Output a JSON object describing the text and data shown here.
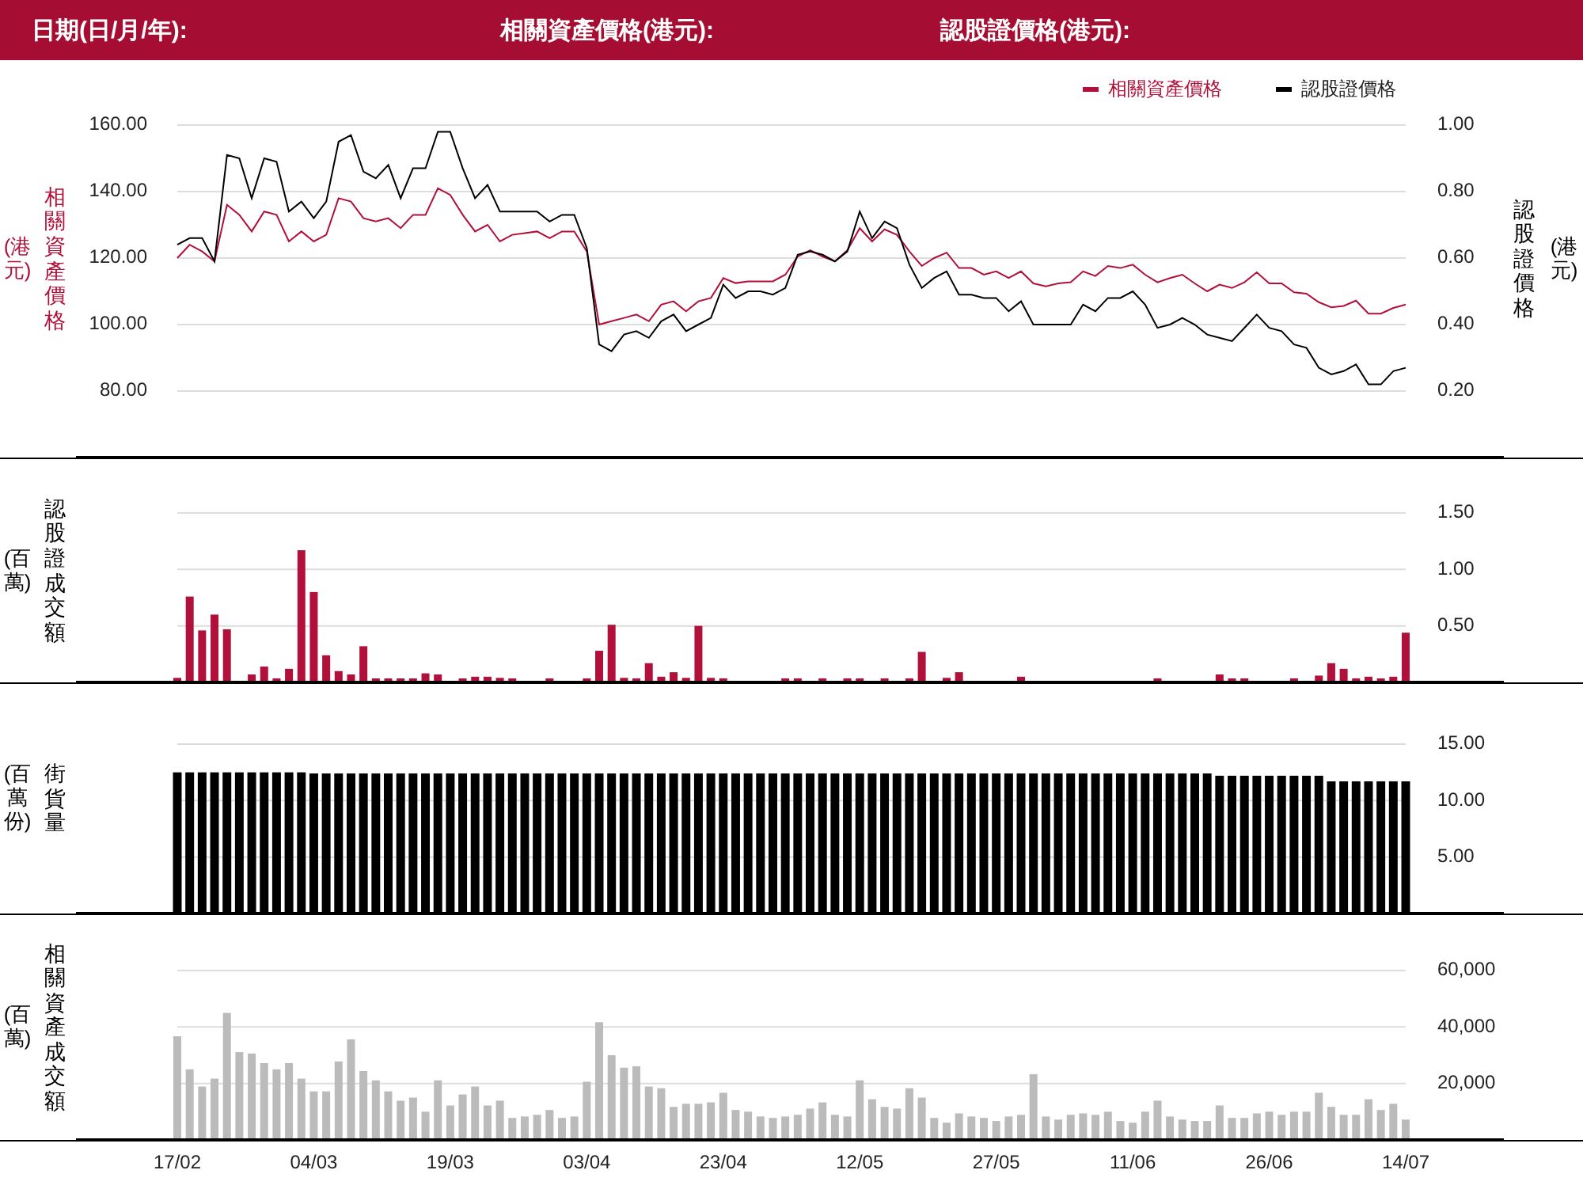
{
  "header": {
    "fields": [
      {
        "label": "日期(日/月/年):"
      },
      {
        "label": "相關資產價格(港元):"
      },
      {
        "label": "認股證價格(港元):"
      }
    ]
  },
  "panels": [
    {
      "unit": "(港元)",
      "chart_data": {
        "type": "line",
        "ylabel": "相關資產價格",
        "grid": true,
        "legend": true,
        "ylim": [
          60,
          160
        ],
        "yticks": [
          {
            "value": 160,
            "label": "160.00"
          },
          {
            "value": 140,
            "label": "140.00"
          },
          {
            "value": 120,
            "label": "120.00"
          },
          {
            "value": 100,
            "label": "100.00"
          },
          {
            "value": 80,
            "label": "80.00"
          }
        ],
        "series": [
          {
            "name": "相關資產價格",
            "color": "#b0103a",
            "values": [
              120,
              124,
              122,
              119,
              136,
              133,
              128,
              134,
              133,
              125,
              128,
              125,
              127,
              138,
              137,
              132,
              131,
              132,
              129,
              133,
              133,
              141,
              139,
              133,
              128,
              130,
              125,
              127,
              127.5,
              128,
              126,
              128,
              128,
              122,
              100,
              101,
              102,
              103,
              101,
              106,
              107,
              104,
              107,
              108,
              114,
              112.5,
              113,
              113,
              113,
              115,
              120.5,
              122.4,
              120.5,
              119,
              122.4,
              129,
              125,
              128.6,
              127,
              122,
              117.6,
              120,
              121.6,
              117,
              117,
              115,
              116,
              114,
              116,
              112.4,
              111.5,
              112.4,
              112.7,
              116,
              114.6,
              117.6,
              117,
              118,
              115,
              112.7,
              114,
              115,
              112.4,
              110,
              112,
              111,
              112.7,
              115.7,
              112.4,
              112.4,
              109.7,
              109.3,
              106.7,
              105.2,
              105.6,
              107.2,
              103.3,
              103.3,
              105,
              106
            ]
          }
        ]
      },
      "overlay": {
        "unit": "(港元)",
        "chart_data": {
          "type": "line",
          "ylabel": "認股證價格",
          "legend": true,
          "ylim": [
            0,
            1.0
          ],
          "yticks": [
            {
              "value": 1.0,
              "label": "1.00"
            },
            {
              "value": 0.8,
              "label": "0.80"
            },
            {
              "value": 0.6,
              "label": "0.60"
            },
            {
              "value": 0.4,
              "label": "0.40"
            },
            {
              "value": 0.2,
              "label": "0.20"
            }
          ],
          "series": [
            {
              "name": "認股證價格",
              "color": "#000000",
              "values": [
                0.64,
                0.66,
                0.66,
                0.59,
                0.91,
                0.9,
                0.78,
                0.9,
                0.89,
                0.74,
                0.77,
                0.72,
                0.77,
                0.95,
                0.97,
                0.86,
                0.84,
                0.88,
                0.78,
                0.87,
                0.87,
                0.98,
                0.98,
                0.87,
                0.78,
                0.82,
                0.74,
                0.74,
                0.74,
                0.74,
                0.71,
                0.73,
                0.73,
                0.63,
                0.34,
                0.32,
                0.37,
                0.38,
                0.36,
                0.41,
                0.43,
                0.38,
                0.4,
                0.42,
                0.52,
                0.48,
                0.5,
                0.5,
                0.49,
                0.51,
                0.61,
                0.62,
                0.61,
                0.59,
                0.62,
                0.74,
                0.66,
                0.71,
                0.69,
                0.58,
                0.51,
                0.54,
                0.56,
                0.49,
                0.49,
                0.48,
                0.48,
                0.44,
                0.47,
                0.4,
                0.4,
                0.4,
                0.4,
                0.46,
                0.44,
                0.48,
                0.48,
                0.5,
                0.46,
                0.39,
                0.4,
                0.42,
                0.4,
                0.37,
                0.36,
                0.35,
                0.39,
                0.43,
                0.39,
                0.38,
                0.34,
                0.33,
                0.27,
                0.25,
                0.26,
                0.28,
                0.22,
                0.22,
                0.26,
                0.27
              ]
            }
          ]
        }
      }
    },
    {
      "unit": "(百萬)",
      "chart_data": {
        "type": "bar",
        "ylabel": "認股證成交額",
        "grid": true,
        "ylim": [
          0,
          1.5
        ],
        "yticks": [
          {
            "value": 1.5,
            "label": "1.50"
          },
          {
            "value": 1.0,
            "label": "1.00"
          },
          {
            "value": 0.5,
            "label": "0.50"
          }
        ],
        "series": [
          {
            "color": "#b0103a",
            "values": [
              0.04,
              0.76,
              0.46,
              0.6,
              0.47,
              0,
              0.07,
              0.14,
              0.03,
              0.12,
              1.17,
              0.8,
              0.24,
              0.1,
              0.07,
              0.32,
              0.02,
              0.03,
              0.02,
              0.02,
              0.08,
              0.07,
              0,
              0.03,
              0.05,
              0.05,
              0.04,
              0.02,
              0,
              0,
              0.02,
              0,
              0,
              0.03,
              0.28,
              0.51,
              0.04,
              0.02,
              0.17,
              0.05,
              0.09,
              0.04,
              0.5,
              0.04,
              0.02,
              0,
              0,
              0,
              0,
              0.02,
              0.02,
              0,
              0.02,
              0,
              0.03,
              0.02,
              0,
              0.03,
              0,
              0.03,
              0.27,
              0,
              0.04,
              0.09,
              0,
              0,
              0,
              0,
              0.05,
              0,
              0,
              0,
              0,
              0,
              0,
              0,
              0,
              0,
              0,
              0.01,
              0,
              0,
              0,
              0,
              0.07,
              0.02,
              0.02,
              0,
              0,
              0,
              0.02,
              0,
              0.06,
              0.17,
              0.12,
              0.02,
              0.05,
              0.01,
              0.05,
              0.44
            ]
          }
        ]
      }
    },
    {
      "unit": "(百萬份)",
      "chart_data": {
        "type": "bar",
        "ylabel": "街貨量",
        "grid": true,
        "ylim": [
          0,
          15
        ],
        "yticks": [
          {
            "value": 15,
            "label": "15.00"
          },
          {
            "value": 10,
            "label": "10.00"
          },
          {
            "value": 5,
            "label": "5.00"
          }
        ],
        "series": [
          {
            "color": "#000000",
            "values": [
              12.5,
              12.5,
              12.5,
              12.5,
              12.5,
              12.5,
              12.5,
              12.5,
              12.5,
              12.5,
              12.5,
              12.4,
              12.4,
              12.4,
              12.4,
              12.4,
              12.4,
              12.4,
              12.4,
              12.4,
              12.4,
              12.4,
              12.4,
              12.4,
              12.4,
              12.4,
              12.4,
              12.4,
              12.4,
              12.4,
              12.4,
              12.4,
              12.4,
              12.4,
              12.4,
              12.4,
              12.4,
              12.4,
              12.4,
              12.4,
              12.4,
              12.4,
              12.4,
              12.4,
              12.4,
              12.4,
              12.4,
              12.4,
              12.4,
              12.4,
              12.4,
              12.4,
              12.4,
              12.4,
              12.4,
              12.4,
              12.4,
              12.4,
              12.4,
              12.4,
              12.4,
              12.4,
              12.4,
              12.4,
              12.4,
              12.4,
              12.4,
              12.4,
              12.4,
              12.4,
              12.4,
              12.4,
              12.4,
              12.4,
              12.4,
              12.4,
              12.4,
              12.4,
              12.4,
              12.4,
              12.4,
              12.4,
              12.4,
              12.4,
              12.2,
              12.2,
              12.2,
              12.2,
              12.2,
              12.2,
              12.2,
              12.2,
              12.2,
              11.7,
              11.7,
              11.7,
              11.7,
              11.7,
              11.7,
              11.7
            ]
          }
        ]
      }
    },
    {
      "unit": "(百萬)",
      "chart_data": {
        "type": "bar",
        "ylabel": "相關資產成交額",
        "grid": true,
        "ylim": [
          0,
          60000
        ],
        "yticks": [
          {
            "value": 60000,
            "label": "60,000"
          },
          {
            "value": 40000,
            "label": "40,000"
          },
          {
            "value": 20000,
            "label": "20,000"
          }
        ],
        "series": [
          {
            "color": "#bbbbbb",
            "values": [
              36700,
              25000,
              18900,
              21700,
              45000,
              31100,
              30600,
              27200,
              25000,
              27200,
              21700,
              17200,
              17200,
              27800,
              35600,
              24400,
              21100,
              17200,
              13900,
              15000,
              10000,
              21100,
              12200,
              16100,
              18900,
              12200,
              13900,
              7800,
              8300,
              8900,
              10600,
              7800,
              8300,
              20600,
              41700,
              30000,
              25600,
              26100,
              18900,
              18300,
              11700,
              12800,
              12800,
              13300,
              16700,
              10600,
              10000,
              8300,
              7800,
              8300,
              8900,
              11100,
              13300,
              8900,
              8300,
              21100,
              14400,
              11700,
              11100,
              18300,
              15000,
              7800,
              6100,
              9400,
              8300,
              7800,
              6700,
              8300,
              8900,
              23300,
              8300,
              7200,
              8900,
              9400,
              8900,
              10000,
              6700,
              6100,
              10000,
              13900,
              8300,
              7200,
              6700,
              6700,
              12200,
              7800,
              7800,
              9400,
              10000,
              8900,
              10000,
              10000,
              16700,
              11700,
              8900,
              8900,
              14400,
              10600,
              12800,
              7200
            ]
          }
        ]
      }
    }
  ],
  "x_axis": {
    "labels": [
      "17/02",
      "04/03",
      "19/03",
      "03/04",
      "23/04",
      "12/05",
      "27/05",
      "11/06",
      "26/06",
      "14/07"
    ]
  }
}
